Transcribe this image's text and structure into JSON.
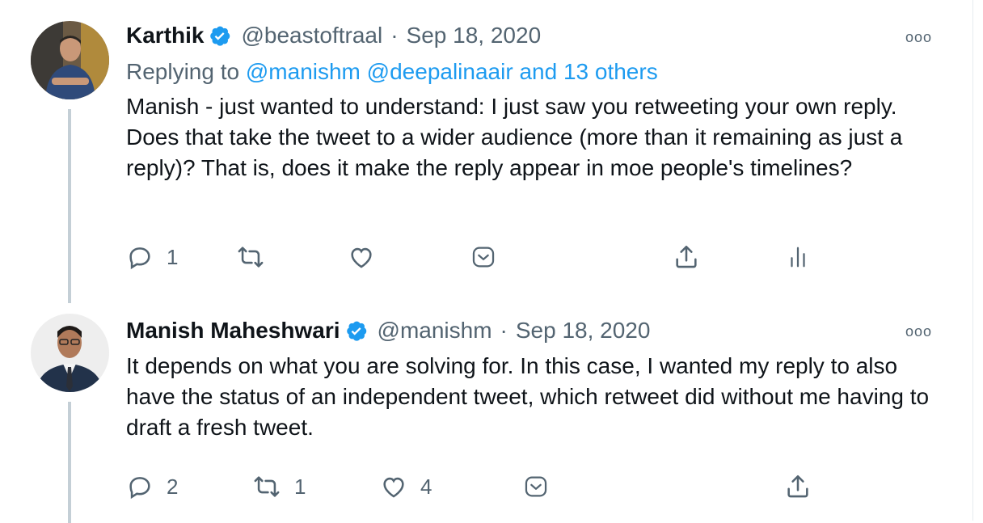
{
  "tweets": [
    {
      "author": {
        "name": "Karthik",
        "handle": "@beastoftraal",
        "verified": true
      },
      "date": "Sep 18, 2020",
      "more_label": "ooo",
      "replying": {
        "prefix": "Replying to",
        "mention1": "@manishm",
        "mention2": "@deepalinaair",
        "others": "and 13 others"
      },
      "text": "Manish - just wanted to understand: I just saw you retweeting your own reply. Does that take the tweet to a wider audience (more than it remaining as just a reply)? That is, does it make the reply appear in moe people's timelines?",
      "actions": {
        "reply_count": "1",
        "retweet_count": "",
        "like_count": ""
      }
    },
    {
      "author": {
        "name": "Manish Maheshwari",
        "handle": "@manishm",
        "verified": true
      },
      "date": "Sep 18, 2020",
      "more_label": "ooo",
      "text": "It depends on what you are solving for. In this case, I wanted my reply to also have the status of an independent tweet, which retweet did without me having to draft a fresh tweet.",
      "actions": {
        "reply_count": "2",
        "retweet_count": "1",
        "like_count": "4"
      }
    }
  ],
  "icons": {
    "verified": "verified-badge-icon",
    "reply": "reply-icon",
    "retweet": "retweet-icon",
    "like": "heart-icon",
    "bookmark": "bookmark-icon",
    "share": "share-icon",
    "analytics": "analytics-icon",
    "more": "more-options-icon"
  },
  "colors": {
    "link": "#1d9bf0",
    "muted": "#536471",
    "text": "#0f1419",
    "thread_line": "#c4cfd6"
  }
}
